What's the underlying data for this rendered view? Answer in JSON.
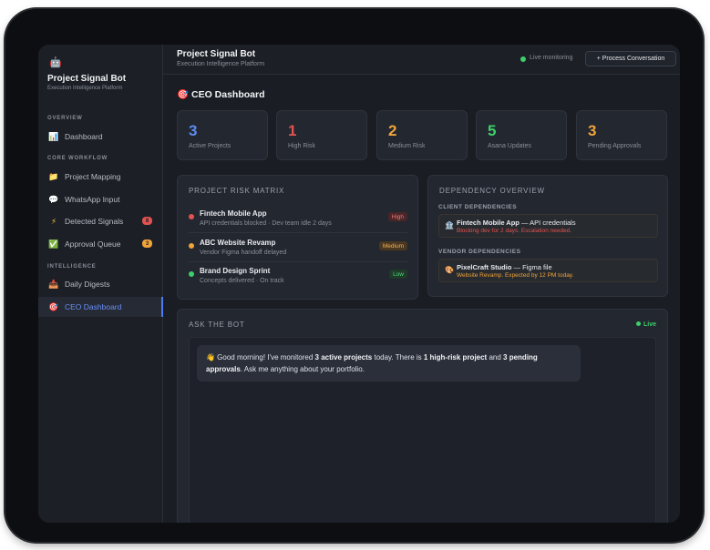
{
  "brand": {
    "icon": "robot-icon",
    "name": "Project Signal Bot",
    "subtitle": "Execution Intelligence Platform"
  },
  "sidebar": {
    "sections": [
      {
        "label": "OVERVIEW",
        "items": [
          {
            "label": "Dashboard",
            "icon": "chart-icon"
          }
        ]
      },
      {
        "label": "CORE WORKFLOW",
        "items": [
          {
            "label": "Project Mapping",
            "icon": "folder-icon"
          },
          {
            "label": "WhatsApp Input",
            "icon": "speech-bubble-icon"
          },
          {
            "label": "Detected Signals",
            "icon": "lightning-icon",
            "badge": "8"
          },
          {
            "label": "Approval Queue",
            "icon": "checkmark-icon",
            "badge": "3"
          }
        ]
      },
      {
        "label": "INTELLIGENCE",
        "items": [
          {
            "label": "Daily Digests",
            "icon": "inbox-icon"
          },
          {
            "label": "CEO Dashboard",
            "icon": "target-icon",
            "active": true
          }
        ]
      }
    ]
  },
  "header": {
    "title": "Project Signal Bot",
    "subtitle": "Execution Intelligence Platform",
    "status": "Live monitoring",
    "action_button": "+ Process Conversation"
  },
  "page": {
    "title": "🎯 CEO Dashboard"
  },
  "stats": [
    {
      "value": "3",
      "label": "Active Projects",
      "color": "#5b8def"
    },
    {
      "value": "1",
      "label": "High Risk",
      "color": "#e2524f"
    },
    {
      "value": "2",
      "label": "Medium Risk",
      "color": "#f0a43a"
    },
    {
      "value": "5",
      "label": "Asana Updates",
      "color": "#3fcf6a"
    },
    {
      "value": "3",
      "label": "Pending Approvals",
      "color": "#f0a43a"
    }
  ],
  "risk_matrix": {
    "title": "PROJECT RISK MATRIX",
    "rows": [
      {
        "name": "Fintech Mobile App",
        "desc": "API credentials blocked · Dev team idle 2 days",
        "tag": "High",
        "color": "#e2524f",
        "tag_bg": "#4a2628",
        "tag_fg": "#f07a75"
      },
      {
        "name": "ABC Website Revamp",
        "desc": "Vendor Figma handoff delayed",
        "tag": "Medium",
        "color": "#f0a43a",
        "tag_bg": "#4a3720",
        "tag_fg": "#f3b35a"
      },
      {
        "name": "Brand Design Sprint",
        "desc": "Concepts delivered · On track",
        "tag": "Low",
        "color": "#3fcf6a",
        "tag_bg": "#1f3b2a",
        "tag_fg": "#4fd97b"
      }
    ]
  },
  "dependencies": {
    "title": "DEPENDENCY OVERVIEW",
    "client": {
      "label": "CLIENT DEPENDENCIES",
      "icon": "building-icon",
      "name": "Fintech Mobile App",
      "detail": "— API credentials",
      "status": "Blocking dev for 2 days. Escalation needed.",
      "status_color": "#e2524f"
    },
    "vendor": {
      "label": "VENDOR DEPENDENCIES",
      "icon": "palette-icon",
      "name": "PixelCraft Studio",
      "detail": "— Figma file",
      "status": "Website Revamp. Expected by 12 PM today.",
      "status_color": "#f0a43a"
    }
  },
  "bot": {
    "title": "ASK THE BOT",
    "live": "Live",
    "message": {
      "greeting": "👋 Good morning! I've monitored ",
      "b1": "3 active projects",
      "t2": " today. There is ",
      "b2": "1 high-risk project",
      "t3": " and ",
      "b3": "3 pending approvals",
      "t4": ". Ask me anything about your portfolio."
    }
  }
}
